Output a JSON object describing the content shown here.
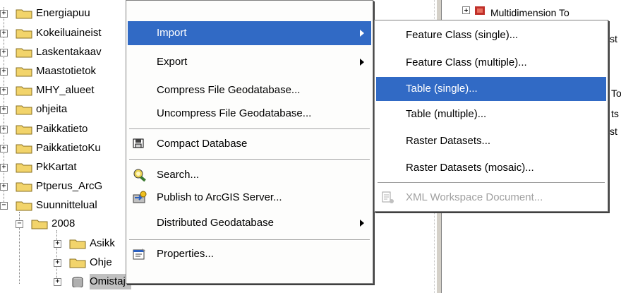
{
  "tree": {
    "items": [
      {
        "label": "Energiapuu",
        "expander": "+"
      },
      {
        "label": "Kokeiluaineist",
        "expander": "+"
      },
      {
        "label": "Laskentakaav",
        "expander": "+"
      },
      {
        "label": "Maastotietok",
        "expander": "+"
      },
      {
        "label": "MHY_alueet",
        "expander": "+"
      },
      {
        "label": "ohjeita",
        "expander": "+"
      },
      {
        "label": "Paikkatieto",
        "expander": "+"
      },
      {
        "label": "PaikkatietoKu",
        "expander": "+"
      },
      {
        "label": "PkKartat",
        "expander": "+"
      },
      {
        "label": "Ptperus_ArcG",
        "expander": "+"
      },
      {
        "label": "Suunnittelual",
        "expander": "−"
      }
    ],
    "sub_items": [
      {
        "label": "2008",
        "expander": "−"
      },
      {
        "label": "Asikk",
        "expander": "+"
      },
      {
        "label": "Ohje",
        "expander": "+"
      },
      {
        "label": "Omistaja",
        "expander": "+"
      }
    ]
  },
  "right_pane": {
    "line1": "Multidimension To",
    "line2": "st",
    "line3": "To",
    "line4": "ts",
    "line5": "st"
  },
  "context_menu": {
    "items": [
      {
        "label": "Import",
        "has_submenu": true,
        "highlighted": true
      },
      {
        "label": "Export",
        "has_submenu": true
      },
      {
        "label": "Compress File Geodatabase..."
      },
      {
        "label": "Uncompress File Geodatabase..."
      },
      {
        "label": "Compact Database",
        "icon": "compact-database-icon"
      },
      {
        "label": "Search...",
        "icon": "search-icon"
      },
      {
        "label": "Publish to ArcGIS Server...",
        "icon": "publish-server-icon"
      },
      {
        "label": "Distributed Geodatabase",
        "has_submenu": true
      },
      {
        "label": "Properties...",
        "icon": "properties-icon"
      }
    ]
  },
  "import_submenu": {
    "items": [
      {
        "label": "Feature Class (single)..."
      },
      {
        "label": "Feature Class (multiple)..."
      },
      {
        "label": "Table (single)...",
        "highlighted": true
      },
      {
        "label": "Table (multiple)..."
      },
      {
        "label": "Raster Datasets..."
      },
      {
        "label": "Raster Datasets (mosaic)..."
      },
      {
        "label": "XML Workspace Document...",
        "disabled": true,
        "icon": "xml-document-icon"
      }
    ]
  },
  "colors": {
    "highlight": "#316ac5",
    "folder": "#f2d46b",
    "disabled_text": "#a0a0a0"
  }
}
